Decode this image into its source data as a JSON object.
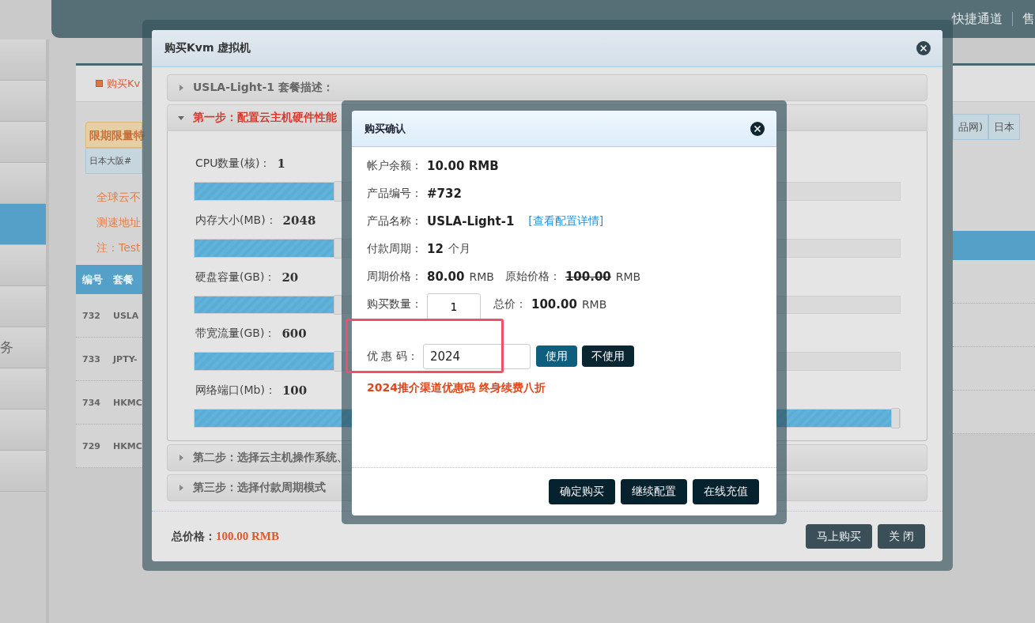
{
  "top_bar": {
    "links": [
      "快捷通道",
      "售"
    ]
  },
  "sidebar": {
    "items": [
      {
        "selected": false
      },
      {
        "selected": false
      },
      {
        "selected": false
      },
      {
        "selected": false
      },
      {
        "selected": true
      },
      {
        "selected": false
      },
      {
        "selected": false
      },
      {
        "label": "务",
        "selected": false
      },
      {
        "selected": false
      },
      {
        "selected": false
      },
      {
        "selected": false
      }
    ]
  },
  "main": {
    "tab": "购买Kv",
    "tags": [
      {
        "label": "限期限量特",
        "kind": "promo"
      },
      {
        "label": "日本大阪#",
        "kind": "region"
      }
    ],
    "notes": [
      "全球云不",
      "测速地址",
      "注：Test"
    ],
    "right_tags": [
      "品网)",
      "日本"
    ],
    "table": {
      "columns": [
        "编号",
        "套餐"
      ],
      "rows": [
        [
          "732",
          "USLA"
        ],
        [
          "733",
          "JPTY-"
        ],
        [
          "734",
          "HKMC"
        ],
        [
          "729",
          "HKMC"
        ]
      ]
    }
  },
  "dialog": {
    "title": "购买Kvm 虚拟机",
    "sections": [
      {
        "title": "USLA-Light-1 套餐描述：",
        "expanded": false,
        "kind": "info"
      },
      {
        "title": "第一步：配置云主机硬件性能",
        "expanded": true,
        "kind": "step"
      },
      {
        "title": "第二步：选择云主机操作系统、",
        "expanded": false,
        "kind": "step"
      },
      {
        "title": "第三步：选择付款周期模式",
        "expanded": false,
        "kind": "step"
      }
    ],
    "sliders": [
      {
        "label": "CPU数量(核)：",
        "value": "1",
        "level": 0.2
      },
      {
        "label": "内存大小(MB)：",
        "value": "2048",
        "level": 0.2
      },
      {
        "label": "硬盘容量(GB)：",
        "value": "20",
        "level": 0.2
      },
      {
        "label": "带宽流量(GB)：",
        "value": "600",
        "level": 0.2
      },
      {
        "label": "网络端口(Mb)：",
        "value": "100",
        "level": 1
      }
    ],
    "total_label": "总价格：",
    "total_value": "100.00 RMB",
    "buttons": [
      "马上购买",
      "关 闭"
    ]
  },
  "confirm": {
    "title": "购买确认",
    "fields": [
      {
        "kind": "plain",
        "label": "帐户余额：",
        "value": "10.00 RMB"
      },
      {
        "kind": "plain",
        "label": "产品编号：",
        "value": "#732"
      },
      {
        "kind": "link",
        "label": "产品名称：",
        "value": "USLA-Light-1",
        "link": "[查看配置详情]"
      },
      {
        "kind": "unit",
        "label": "付款周期：",
        "value": "12",
        "unit": "个月"
      },
      {
        "kind": "price",
        "label": "周期价格：",
        "value": "80.00",
        "unit": "RMB",
        "label2": "原始价格：",
        "value2": "100.00",
        "unit2": "RMB"
      },
      {
        "kind": "quantity",
        "label": "购买数量：",
        "value": "1",
        "label2": "总价：",
        "value2": "100.00",
        "unit2": "RMB"
      }
    ],
    "coupon": {
      "label": "优 惠 码：",
      "value": "2024",
      "highlighted": true,
      "buttons": [
        {
          "label": "使用",
          "kind": "primary"
        },
        {
          "label": "不使用",
          "kind": "dark"
        }
      ]
    },
    "promo": "2024推介渠道优惠码 终身续费八折",
    "buttons": [
      "确定购买",
      "继续配置",
      "在线充值"
    ]
  }
}
